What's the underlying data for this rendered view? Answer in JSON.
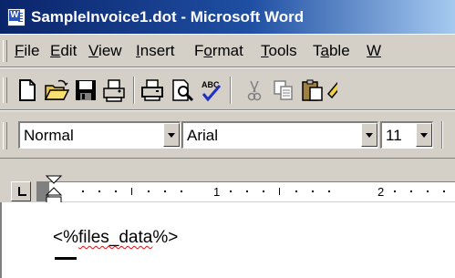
{
  "window": {
    "title": "SampleInvoice1.dot - Microsoft Word"
  },
  "menubar": {
    "items": [
      {
        "underline": "F",
        "rest": "ile"
      },
      {
        "underline": "E",
        "rest": "dit"
      },
      {
        "underline": "V",
        "rest": "iew"
      },
      {
        "underline": "I",
        "rest": "nsert"
      },
      {
        "pre": "F",
        "underline": "o",
        "rest": "rmat"
      },
      {
        "underline": "T",
        "rest": "ools"
      },
      {
        "pre": "T",
        "underline": "a",
        "rest": "ble"
      },
      {
        "underline": "W",
        "rest": ""
      }
    ]
  },
  "toolbar_standard": {
    "buttons": [
      "new-document-icon",
      "open-folder-icon",
      "save-disk-icon",
      "permission-icon",
      "print-icon",
      "print-preview-icon",
      "spelling-grammar-icon",
      "cut-scissors-icon",
      "copy-icon",
      "paste-icon",
      "format-painter-icon"
    ]
  },
  "toolbar_formatting": {
    "style": "Normal",
    "font": "Arial",
    "size": "11"
  },
  "ruler": {
    "numbers": [
      "1",
      "2"
    ]
  },
  "document": {
    "text_prefix": "<%",
    "text_field": "files_data",
    "text_suffix": "%>"
  }
}
